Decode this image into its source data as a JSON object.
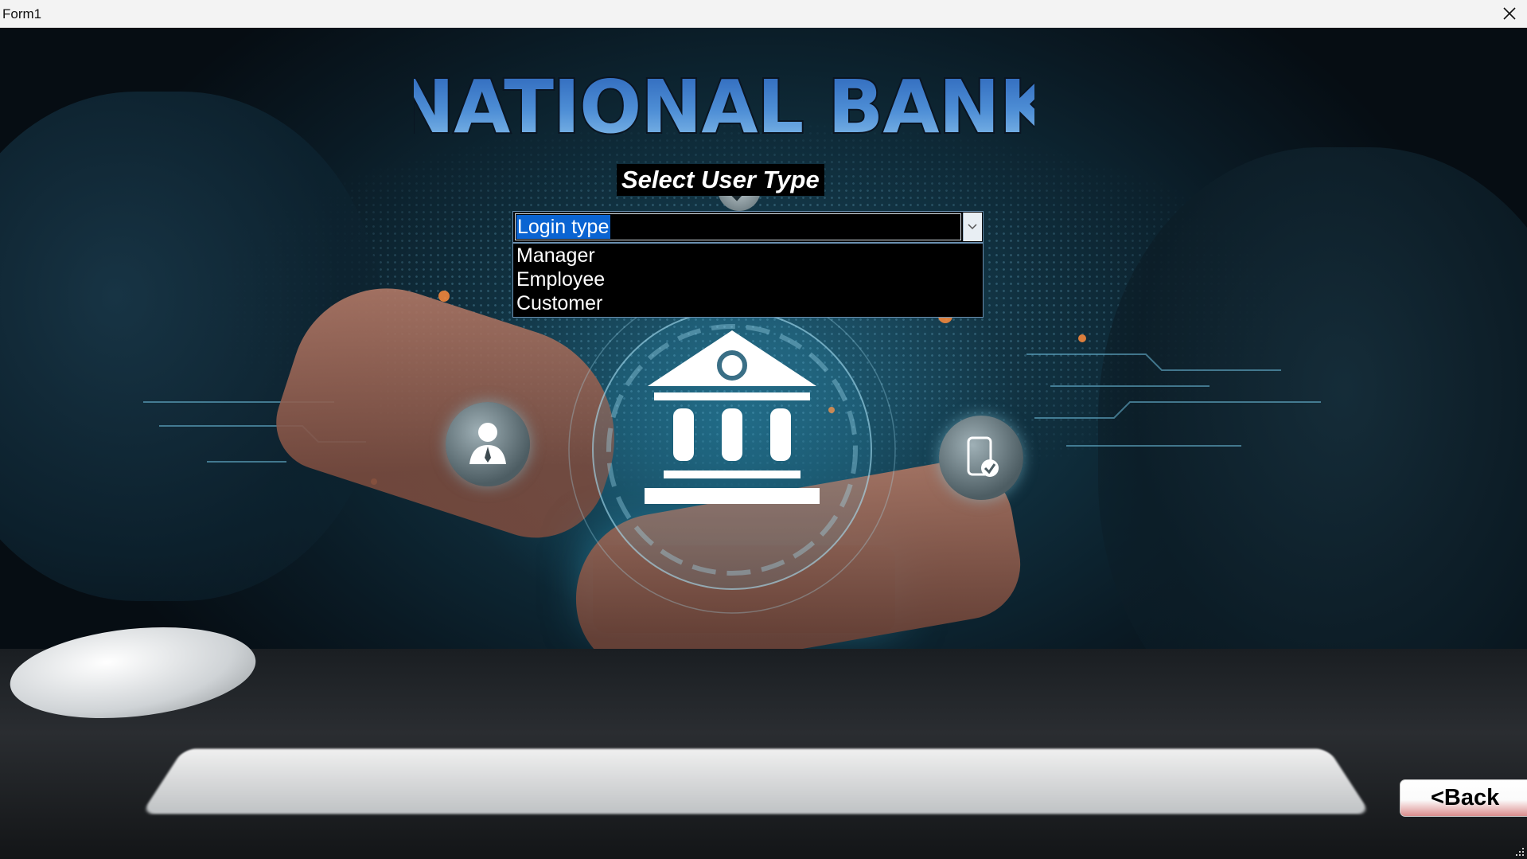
{
  "window": {
    "title": "Form1",
    "close_icon": "close-icon"
  },
  "header": {
    "bank_name": "NATIONAL BANK",
    "subtitle": "Select User Type"
  },
  "login_type": {
    "selected_text": "Login type",
    "options": [
      "Manager",
      "Employee",
      "Customer"
    ],
    "expanded": true,
    "dropdown_icon": "chevron-down-icon"
  },
  "actions": {
    "back_label": "<Back"
  },
  "background": {
    "icons": [
      "bank-building-icon",
      "businessman-icon",
      "mobile-check-icon",
      "checkmark-icon"
    ]
  },
  "colors": {
    "title_gradient_top": "#2a63b8",
    "title_gradient_bottom": "#8cc3ec",
    "selection_highlight": "#0a64d2",
    "dropdown_background": "#000000",
    "back_button_accent": "#d98d8d"
  }
}
